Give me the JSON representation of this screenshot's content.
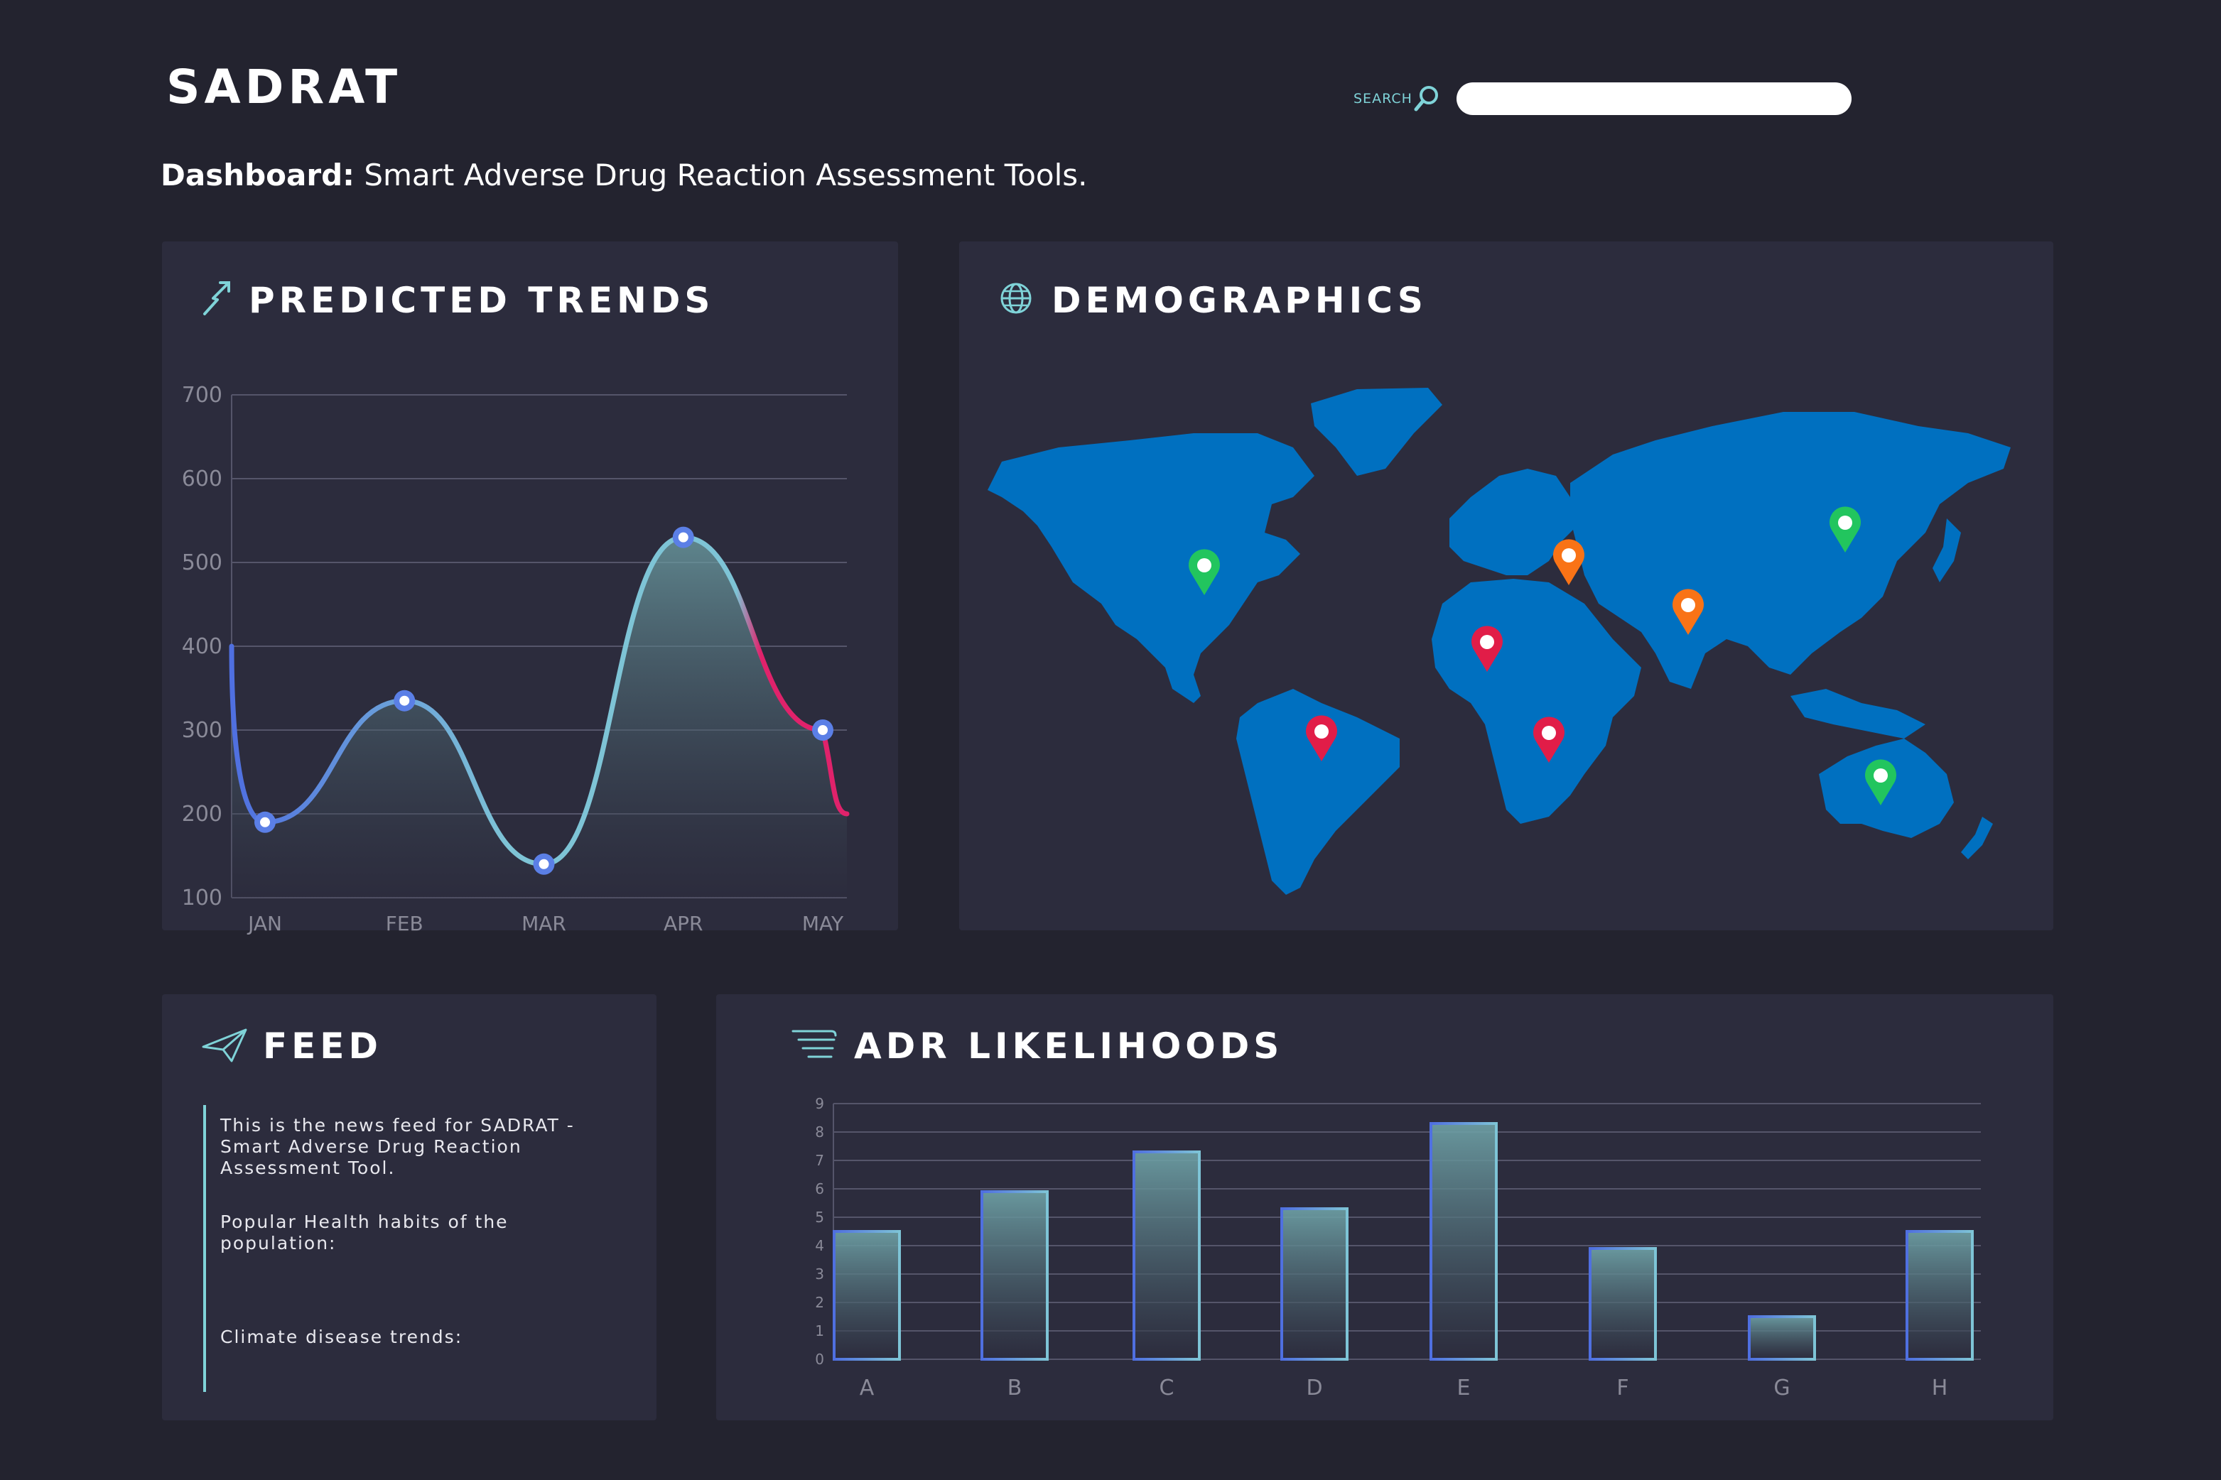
{
  "app": {
    "brand": "SADRAT",
    "search_label": "SEARCH",
    "search_value": "",
    "subtitle_bold": "Dashboard:",
    "subtitle_rest": "Smart Adverse Drug Reaction Assessment Tools."
  },
  "panels": {
    "trends_title": "PREDICTED TRENDS",
    "demographics_title": "DEMOGRAPHICS",
    "feed_title": "FEED",
    "adr_title": "ADR LIKELIHOODS"
  },
  "feed": {
    "items": [
      "This is the news feed for SADRAT - Smart Adverse Drug Reaction Assessment Tool.",
      "Popular Health habits of the population:",
      "Climate disease trends:"
    ]
  },
  "map": {
    "land_color": "#0070c0",
    "markers": [
      {
        "region": "north-america",
        "color": "#22c55e"
      },
      {
        "region": "south-america",
        "color": "#e11d48"
      },
      {
        "region": "west-africa",
        "color": "#e11d48"
      },
      {
        "region": "central-africa",
        "color": "#e11d48"
      },
      {
        "region": "europe",
        "color": "#f97316"
      },
      {
        "region": "south-asia",
        "color": "#f97316"
      },
      {
        "region": "east-asia",
        "color": "#22c55e"
      },
      {
        "region": "australia",
        "color": "#22c55e"
      }
    ]
  },
  "chart_data": [
    {
      "type": "line",
      "title": "PREDICTED TRENDS",
      "categories": [
        "JAN",
        "FEB",
        "MAR",
        "APR",
        "MAY"
      ],
      "y_ticks": [
        100,
        200,
        300,
        400,
        500,
        600,
        700
      ],
      "ylim": [
        100,
        700
      ],
      "series": [
        {
          "values": [
            190,
            335,
            140,
            530,
            300
          ]
        }
      ],
      "colors": [
        "#4f6fe0",
        "#7ec4d6",
        "#e0226b"
      ],
      "grid": true
    },
    {
      "type": "bar",
      "title": "ADR LIKELIHOODS",
      "categories": [
        "A",
        "B",
        "C",
        "D",
        "E",
        "F",
        "G",
        "H"
      ],
      "values": [
        4.5,
        5.9,
        7.3,
        5.3,
        8.3,
        3.9,
        1.5,
        4.5
      ],
      "y_ticks": [
        0,
        1,
        2,
        3,
        4,
        5,
        6,
        7,
        8,
        9
      ],
      "ylim": [
        0,
        9
      ],
      "grid": true
    }
  ]
}
